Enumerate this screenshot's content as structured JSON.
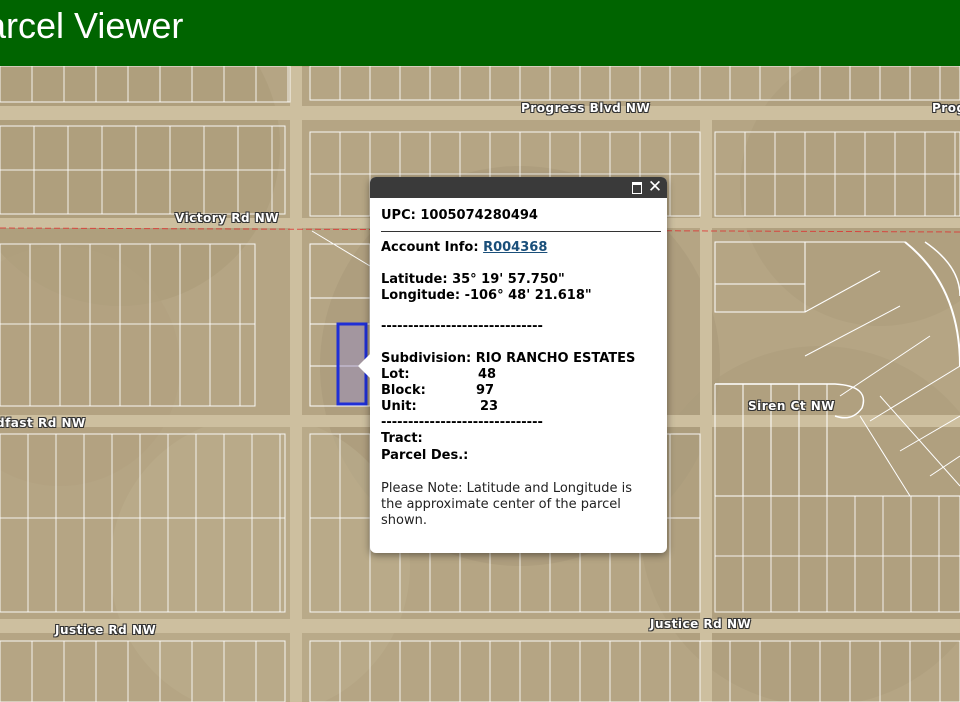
{
  "header": {
    "title": "arcel Viewer"
  },
  "streets": {
    "progress_blvd": "Progress Blvd NW",
    "progress_edge": "Prog",
    "victory_rd": "Victory Rd NW",
    "belfast_rd": "dfast Rd NW",
    "siren_ct": "Siren Ct NW",
    "justice_rd_left": "Justice Rd NW",
    "justice_rd_right": "Justice Rd NW"
  },
  "popup": {
    "upc_label": "UPC:",
    "upc_value": "1005074280494",
    "account_label": "Account Info:",
    "account_value": "R004368",
    "latitude_label": "Latitude:",
    "latitude_value": "35° 19' 57.750\"",
    "longitude_label": "Longitude:",
    "longitude_value": "-106° 48' 21.618\"",
    "dashes": "------------------------------",
    "subdivision_label": "Subdivision:",
    "subdivision_value": "RIO RANCHO ESTATES",
    "lot_label": "Lot:",
    "lot_value": "48",
    "block_label": "Block:",
    "block_value": "97",
    "unit_label": "Unit:",
    "unit_value": "23",
    "tract_label": "Tract:",
    "parcel_des_label": "Parcel Des.:",
    "note": "Please Note: Latitude and Longitude is the approximate center of the parcel shown."
  },
  "colors": {
    "header_bg": "#006400",
    "selected_parcel": "#1f2fd6",
    "parcel_line": "#ffffff",
    "boundary_line": "#e03030"
  },
  "icons": {
    "maximize": "maximize-icon",
    "close": "close-icon"
  }
}
